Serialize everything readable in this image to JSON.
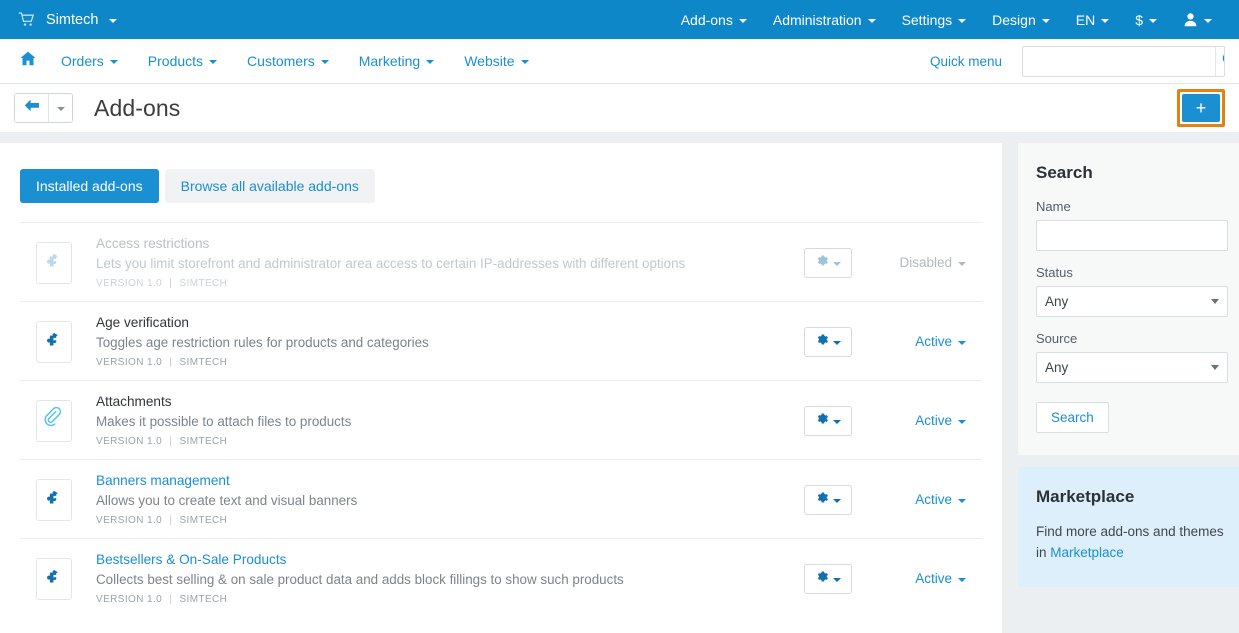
{
  "topbar": {
    "cart_icon": "cart-icon",
    "brand": "Simtech",
    "nav": [
      {
        "label": "Add-ons",
        "caret": true
      },
      {
        "label": "Administration",
        "caret": true
      },
      {
        "label": "Settings",
        "caret": true
      },
      {
        "label": "Design",
        "caret": true
      },
      {
        "label": "EN",
        "caret": true
      },
      {
        "label": "$",
        "caret": true
      }
    ],
    "user_icon": "user-icon"
  },
  "mainnav": {
    "home_icon": "home-icon",
    "items": [
      {
        "label": "Orders"
      },
      {
        "label": "Products"
      },
      {
        "label": "Customers"
      },
      {
        "label": "Marketing"
      },
      {
        "label": "Website"
      }
    ],
    "quick_menu": "Quick menu",
    "search_value": "",
    "search_placeholder": "",
    "search_icon": "search-icon"
  },
  "titlebar": {
    "back_icon": "arrow-left-icon",
    "back_caret_icon": "chevron-down-icon",
    "title": "Add-ons",
    "add_label": "+",
    "highlight_color": "#e08214"
  },
  "tabs": [
    {
      "label": "Installed add-ons",
      "active": true
    },
    {
      "label": "Browse all available add-ons",
      "active": false
    }
  ],
  "addons": [
    {
      "icon": "puzzle-piece-icon",
      "name": "Access restrictions",
      "description": "Lets you limit storefront and administrator area access to certain IP-addresses with different options",
      "version": "VERSION 1.0",
      "vendor": "SIMTECH",
      "status": "Disabled",
      "disabled": true,
      "link": false
    },
    {
      "icon": "puzzle-piece-icon",
      "name": "Age verification",
      "description": "Toggles age restriction rules for products and categories",
      "version": "VERSION 1.0",
      "vendor": "SIMTECH",
      "status": "Active",
      "disabled": false,
      "link": false
    },
    {
      "icon": "paperclip-icon",
      "name": "Attachments",
      "description": "Makes it possible to attach files to products",
      "version": "VERSION 1.0",
      "vendor": "SIMTECH",
      "status": "Active",
      "disabled": false,
      "link": false
    },
    {
      "icon": "puzzle-piece-icon",
      "name": "Banners management",
      "description": "Allows you to create text and visual banners",
      "version": "VERSION 1.0",
      "vendor": "SIMTECH",
      "status": "Active",
      "disabled": false,
      "link": true
    },
    {
      "icon": "puzzle-piece-icon",
      "name": "Bestsellers & On-Sale Products",
      "description": "Collects best selling & on sale product data and adds block fillings to show such products",
      "version": "VERSION 1.0",
      "vendor": "SIMTECH",
      "status": "Active",
      "disabled": false,
      "link": true
    }
  ],
  "sidebar": {
    "search": {
      "title": "Search",
      "name_label": "Name",
      "name_value": "",
      "name_placeholder": "",
      "status_label": "Status",
      "status_value": "Any",
      "source_label": "Source",
      "source_value": "Any",
      "submit_label": "Search"
    },
    "marketplace": {
      "title": "Marketplace",
      "text_before": "Find more add-ons and themes in ",
      "link": "Marketplace"
    }
  },
  "colors": {
    "brand_blue": "#0e87c8",
    "link_blue": "#1a8fd1",
    "page_bg": "#eceff1",
    "highlight_orange": "#e08214",
    "marketplace_bg": "#ddeffb"
  }
}
